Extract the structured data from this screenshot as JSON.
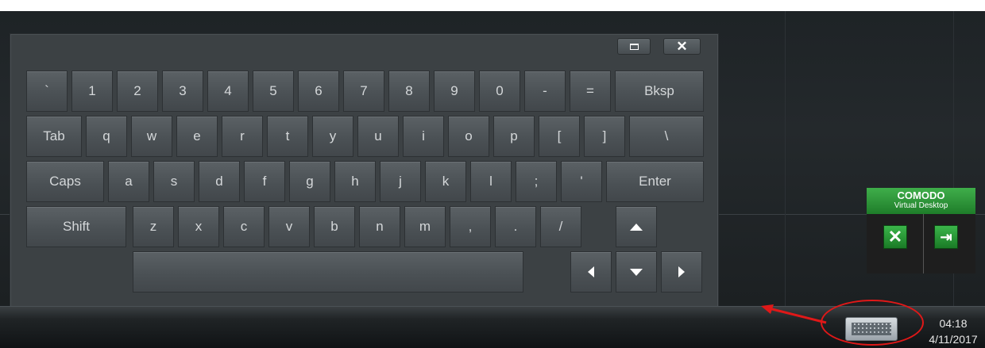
{
  "keyboard": {
    "window_controls": {
      "restore_icon": "restore-icon",
      "close_label": "✕"
    },
    "rows": [
      [
        "`",
        "1",
        "2",
        "3",
        "4",
        "5",
        "6",
        "7",
        "8",
        "9",
        "0",
        "-",
        "=",
        "Bksp"
      ],
      [
        "Tab",
        "q",
        "w",
        "e",
        "r",
        "t",
        "y",
        "u",
        "i",
        "o",
        "p",
        "[",
        "]",
        "\\"
      ],
      [
        "Caps",
        "a",
        "s",
        "d",
        "f",
        "g",
        "h",
        "j",
        "k",
        "l",
        ";",
        "'",
        "Enter"
      ],
      [
        "Shift",
        "z",
        "x",
        "c",
        "v",
        "b",
        "n",
        "m",
        ",",
        ".",
        "/"
      ]
    ],
    "arrow_keys": [
      "up-arrow-icon",
      "left-arrow-icon",
      "down-arrow-icon",
      "right-arrow-icon"
    ]
  },
  "comodo_widget": {
    "title": "COMODO",
    "subtitle": "Virtual Desktop",
    "close_icon": "✕",
    "exit_icon": "⇥",
    "accent": "#2e9a3a"
  },
  "taskbar": {
    "time": "04:18",
    "date": "4/11/2017",
    "tray_icon": "keyboard-icon"
  },
  "annotation": {
    "color": "#e01818"
  }
}
